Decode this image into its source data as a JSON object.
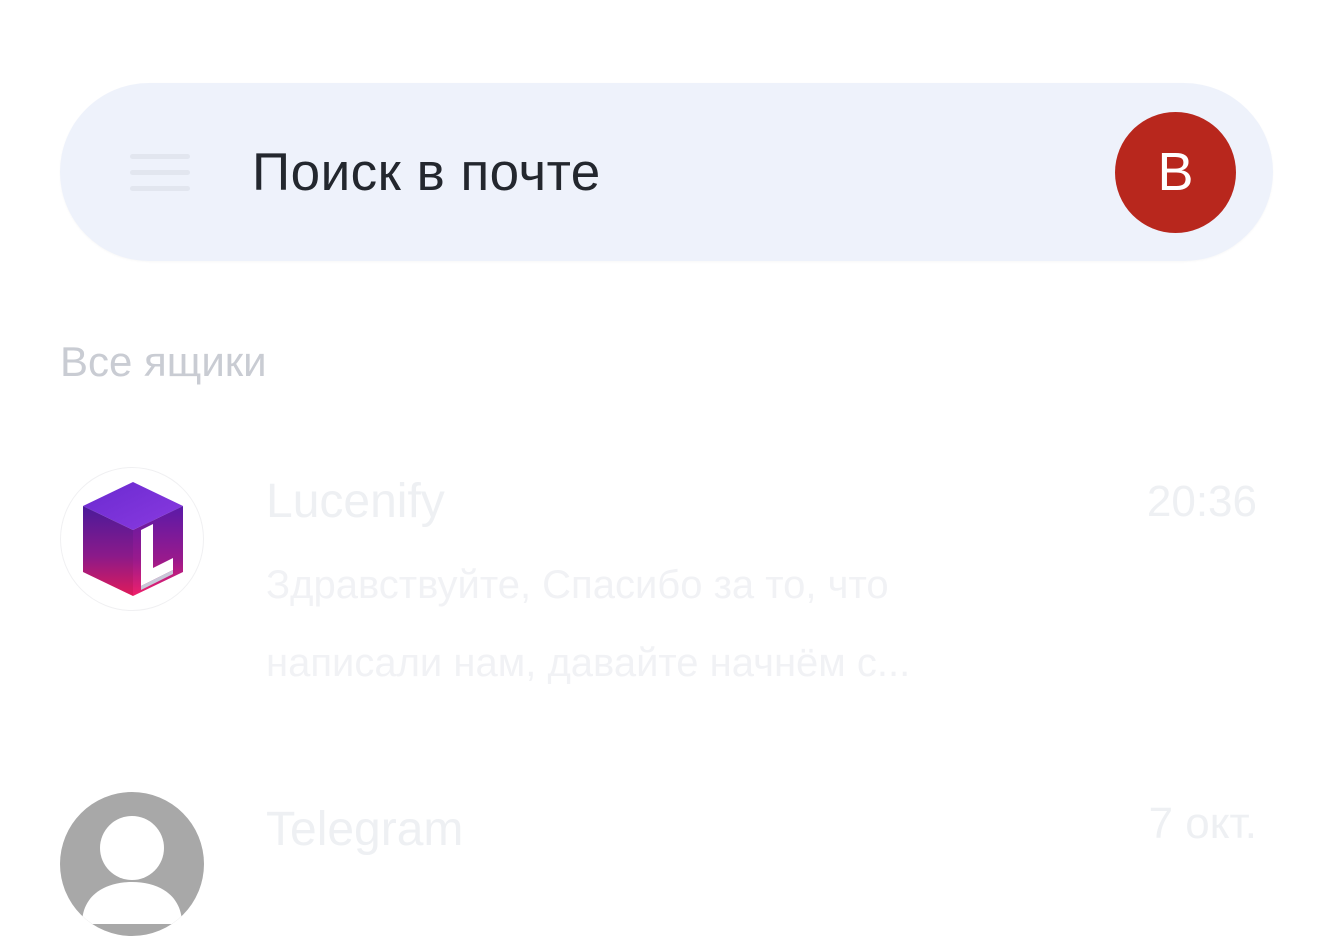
{
  "search": {
    "placeholder": "Поиск в почте",
    "menu_icon": "hamburger-menu-icon"
  },
  "account": {
    "initial": "В",
    "color": "#b8271d"
  },
  "section": {
    "title": "Все ящики"
  },
  "messages": [
    {
      "sender": "Lucenify",
      "time": "20:36",
      "snippet_line1": "Здравствуйте, Спасибо за то, что",
      "snippet_line2": "написали нам, давайте начнём с...",
      "avatar": "lucenify-cube-logo",
      "avatar_letter": "L"
    },
    {
      "sender": "Telegram",
      "time": "7 окт.",
      "avatar": "default-person-icon"
    }
  ]
}
